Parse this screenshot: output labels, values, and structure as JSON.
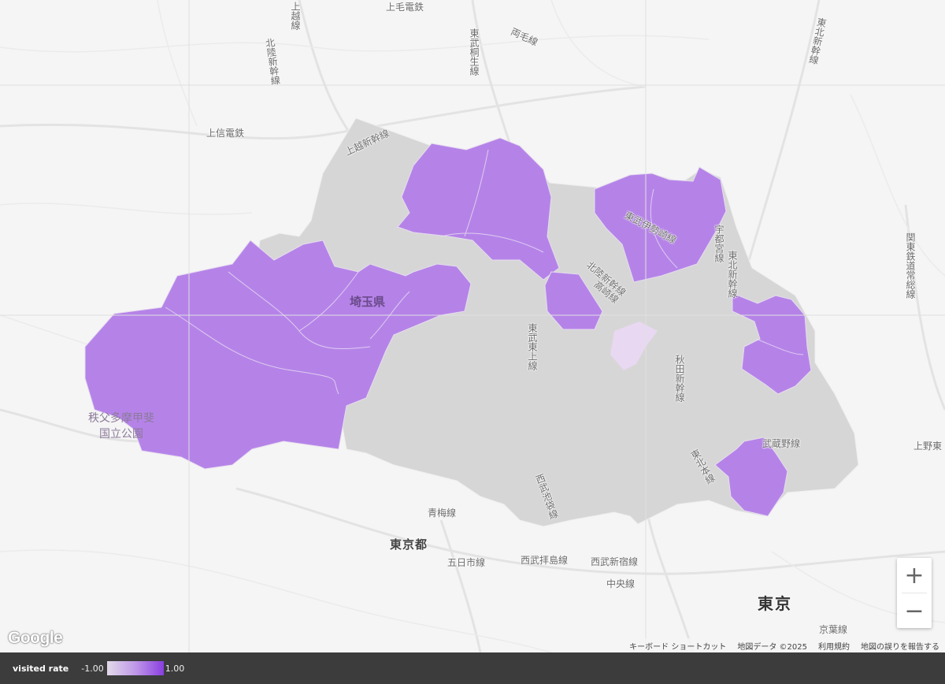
{
  "map": {
    "region_label": "埼玉県",
    "city_label": "東京",
    "pref_label": "東京都",
    "park_label_line1": "秩父多摩甲斐",
    "park_label_line2": "国立公園",
    "lines": [
      "上越線",
      "上毛電鉄",
      "北陸新幹線",
      "東武桐生線",
      "両毛線",
      "東北新幹線",
      "上信電鉄",
      "上越新幹線",
      "東武伊勢崎線",
      "北陸新幹線",
      "高崎線",
      "宇都宮線",
      "東北新幹線",
      "東武東上線",
      "秋田新幹線",
      "関東鉄道常総線",
      "武蔵野線",
      "東北本線",
      "西武池袋線",
      "青梅線",
      "五日市線",
      "西武拝島線",
      "西武新宿線",
      "中央線",
      "京葉線",
      "上野東"
    ],
    "colors": {
      "visited": "#b583e8",
      "unvisited": "#d5d5d5",
      "partial": "#e7d4f0",
      "border": "#eeeeee"
    }
  },
  "controls": {
    "zoom_in": "+",
    "zoom_out": "−"
  },
  "branding": {
    "google": "Google"
  },
  "attribution": {
    "shortcuts": "キーボード ショートカット",
    "data": "地図データ ©2025",
    "terms": "利用規約",
    "report": "地図の誤りを報告する"
  },
  "legend": {
    "title": "visited rate",
    "min": "-1.00",
    "max": "1.00",
    "gradient": [
      "#e2dae9",
      "#bf98e8",
      "#8a3fe0"
    ]
  }
}
